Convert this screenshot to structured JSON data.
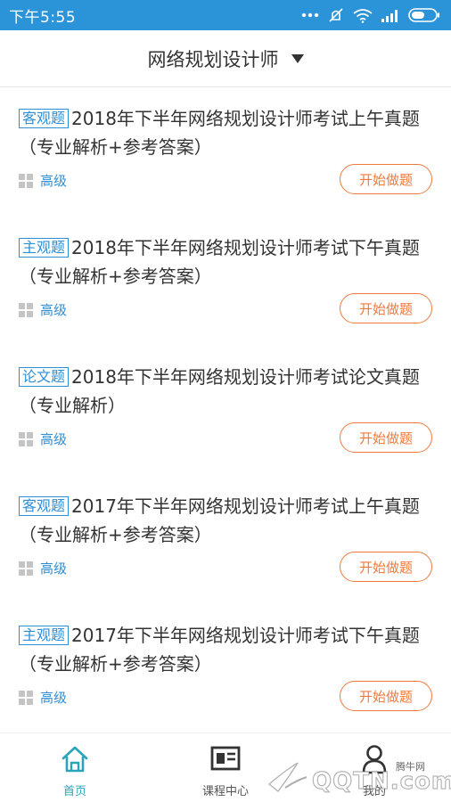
{
  "status_bar": {
    "time": "下午5:55",
    "icons": [
      "more-dots-icon",
      "mute-icon",
      "wifi-icon",
      "signal-icon",
      "battery-icon"
    ]
  },
  "header": {
    "title": "网络规划设计师"
  },
  "items": [
    {
      "tag": "客观题",
      "title": "2018年下半年网络规划设计师考试上午真题（专业解析+参考答案）",
      "level": "高级",
      "button": "开始做题"
    },
    {
      "tag": "主观题",
      "title": "2018年下半年网络规划设计师考试下午真题（专业解析+参考答案）",
      "level": "高级",
      "button": "开始做题"
    },
    {
      "tag": "论文题",
      "title": "2018年下半年网络规划设计师考试论文真题（专业解析）",
      "level": "高级",
      "button": "开始做题"
    },
    {
      "tag": "客观题",
      "title": "2017年下半年网络规划设计师考试上午真题（专业解析+参考答案）",
      "level": "高级",
      "button": "开始做题"
    },
    {
      "tag": "主观题",
      "title": "2017年下半年网络规划设计师考试下午真题（专业解析+参考答案）",
      "level": "高级",
      "button": "开始做题"
    }
  ],
  "bottom_nav": {
    "home": "首页",
    "course": "课程中心",
    "me": "我的"
  },
  "watermark": {
    "text": "QQTN.com",
    "sub": "腾牛网"
  },
  "colors": {
    "status_bar": "#2b93d8",
    "tag_blue": "#2e8fd6",
    "button_orange": "#f07a3c",
    "nav_active": "#2aa4b8"
  }
}
